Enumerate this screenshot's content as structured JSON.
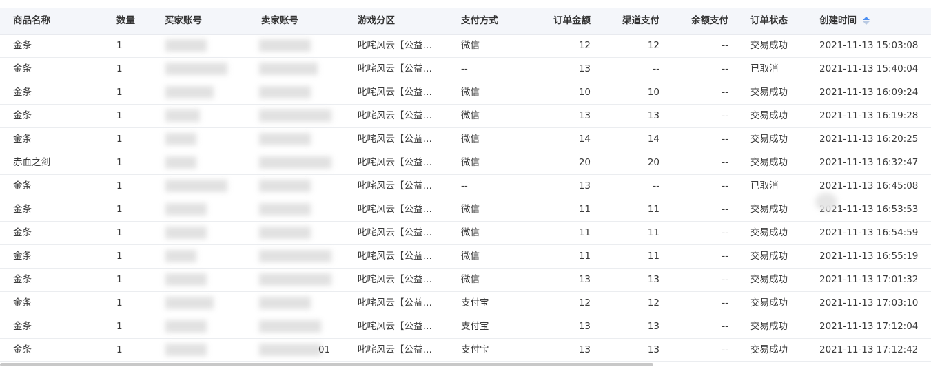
{
  "columns": {
    "product": "商品名称",
    "qty": "数量",
    "buyer": "买家账号",
    "seller": "卖家账号",
    "zone": "游戏分区",
    "payment": "支付方式",
    "amount": "订单金额",
    "channel": "渠道支付",
    "balance": "余额支付",
    "status": "订单状态",
    "created": "创建时间"
  },
  "sort": {
    "column": "created",
    "icon": "sort-caret-icon",
    "active_color": "#4a8ef2"
  },
  "rows": [
    {
      "product": "金条",
      "qty": "1",
      "zone": "叱咤风云【公益…",
      "payment": "微信",
      "amount": "12",
      "channel": "12",
      "balance": "--",
      "status": "交易成功",
      "created": "2021-11-13 15:03:08"
    },
    {
      "product": "金条",
      "qty": "1",
      "zone": "叱咤风云【公益…",
      "payment": "--",
      "amount": "13",
      "channel": "--",
      "balance": "--",
      "status": "已取消",
      "created": "2021-11-13 15:40:04"
    },
    {
      "product": "金条",
      "qty": "1",
      "zone": "叱咤风云【公益…",
      "payment": "微信",
      "amount": "10",
      "channel": "10",
      "balance": "--",
      "status": "交易成功",
      "created": "2021-11-13 16:09:24"
    },
    {
      "product": "金条",
      "qty": "1",
      "zone": "叱咤风云【公益…",
      "payment": "微信",
      "amount": "13",
      "channel": "13",
      "balance": "--",
      "status": "交易成功",
      "created": "2021-11-13 16:19:28"
    },
    {
      "product": "金条",
      "qty": "1",
      "zone": "叱咤风云【公益…",
      "payment": "微信",
      "amount": "14",
      "channel": "14",
      "balance": "--",
      "status": "交易成功",
      "created": "2021-11-13 16:20:25"
    },
    {
      "product": "赤血之剑",
      "qty": "1",
      "zone": "叱咤风云【公益…",
      "payment": "微信",
      "amount": "20",
      "channel": "20",
      "balance": "--",
      "status": "交易成功",
      "created": "2021-11-13 16:32:47"
    },
    {
      "product": "金条",
      "qty": "1",
      "zone": "叱咤风云【公益…",
      "payment": "--",
      "amount": "13",
      "channel": "--",
      "balance": "--",
      "status": "已取消",
      "created": "2021-11-13 16:45:08"
    },
    {
      "product": "金条",
      "qty": "1",
      "zone": "叱咤风云【公益…",
      "payment": "微信",
      "amount": "11",
      "channel": "11",
      "balance": "--",
      "status": "交易成功",
      "created": "2021-11-13 16:53:53"
    },
    {
      "product": "金条",
      "qty": "1",
      "zone": "叱咤风云【公益…",
      "payment": "微信",
      "amount": "11",
      "channel": "11",
      "balance": "--",
      "status": "交易成功",
      "created": "2021-11-13 16:54:59"
    },
    {
      "product": "金条",
      "qty": "1",
      "zone": "叱咤风云【公益…",
      "payment": "微信",
      "amount": "11",
      "channel": "11",
      "balance": "--",
      "status": "交易成功",
      "created": "2021-11-13 16:55:19"
    },
    {
      "product": "金条",
      "qty": "1",
      "zone": "叱咤风云【公益…",
      "payment": "微信",
      "amount": "13",
      "channel": "13",
      "balance": "--",
      "status": "交易成功",
      "created": "2021-11-13 17:01:32"
    },
    {
      "product": "金条",
      "qty": "1",
      "zone": "叱咤风云【公益…",
      "payment": "支付宝",
      "amount": "12",
      "channel": "12",
      "balance": "--",
      "status": "交易成功",
      "created": "2021-11-13 17:03:10"
    },
    {
      "product": "金条",
      "qty": "1",
      "zone": "叱咤风云【公益…",
      "payment": "支付宝",
      "amount": "13",
      "channel": "13",
      "balance": "--",
      "status": "交易成功",
      "created": "2021-11-13 17:12:04"
    },
    {
      "product": "金条",
      "qty": "1",
      "zone": "叱咤风云【公益…",
      "payment": "支付宝",
      "amount": "13",
      "channel": "13",
      "balance": "--",
      "status": "交易成功",
      "created": "2021-11-13 17:12:42",
      "seller_visible": "01"
    }
  ]
}
